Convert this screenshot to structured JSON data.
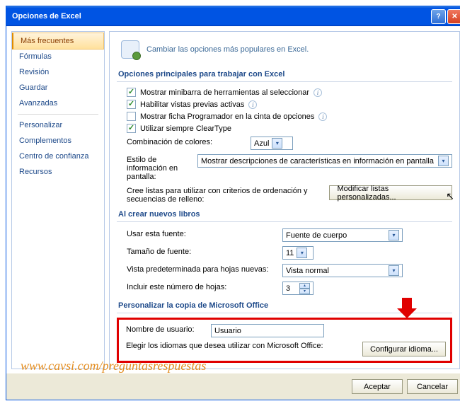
{
  "window": {
    "title": "Opciones de Excel"
  },
  "sidebar": {
    "items": [
      {
        "label": "Más frecuentes"
      },
      {
        "label": "Fórmulas"
      },
      {
        "label": "Revisión"
      },
      {
        "label": "Guardar"
      },
      {
        "label": "Avanzadas"
      },
      {
        "label": "Personalizar"
      },
      {
        "label": "Complementos"
      },
      {
        "label": "Centro de confianza"
      },
      {
        "label": "Recursos"
      }
    ]
  },
  "header": {
    "text": "Cambiar las opciones más populares en Excel."
  },
  "section1": {
    "title": "Opciones principales para trabajar con Excel",
    "opt1": "Mostrar minibarra de herramientas al seleccionar",
    "opt2": "Habilitar vistas previas activas",
    "opt3": "Mostrar ficha Programador en la cinta de opciones",
    "opt4": "Utilizar siempre ClearType",
    "colorLabel": "Combinación de colores:",
    "colorValue": "Azul",
    "styleLabel": "Estilo de información en pantalla:",
    "styleValue": "Mostrar descripciones de características en información en pantalla",
    "listsLabel": "Cree listas para utilizar con criterios de ordenación y secuencias de relleno:",
    "listsBtn": "Modificar listas personalizadas..."
  },
  "section2": {
    "title": "Al crear nuevos libros",
    "fontLabel": "Usar esta fuente:",
    "fontValue": "Fuente de cuerpo",
    "sizeLabel": "Tamaño de fuente:",
    "sizeValue": "11",
    "viewLabel": "Vista predeterminada para hojas nuevas:",
    "viewValue": "Vista normal",
    "sheetsLabel": "Incluir este número de hojas:",
    "sheetsValue": "3"
  },
  "section3": {
    "title": "Personalizar la copia de Microsoft Office",
    "userLabel": "Nombre de usuario:",
    "userValue": "Usuario",
    "langLabel": "Elegir los idiomas que desea utilizar con Microsoft Office:",
    "langBtn": "Configurar idioma..."
  },
  "footer": {
    "ok": "Aceptar",
    "cancel": "Cancelar"
  },
  "watermark": "www.cavsi.com/preguntasrespuestas"
}
